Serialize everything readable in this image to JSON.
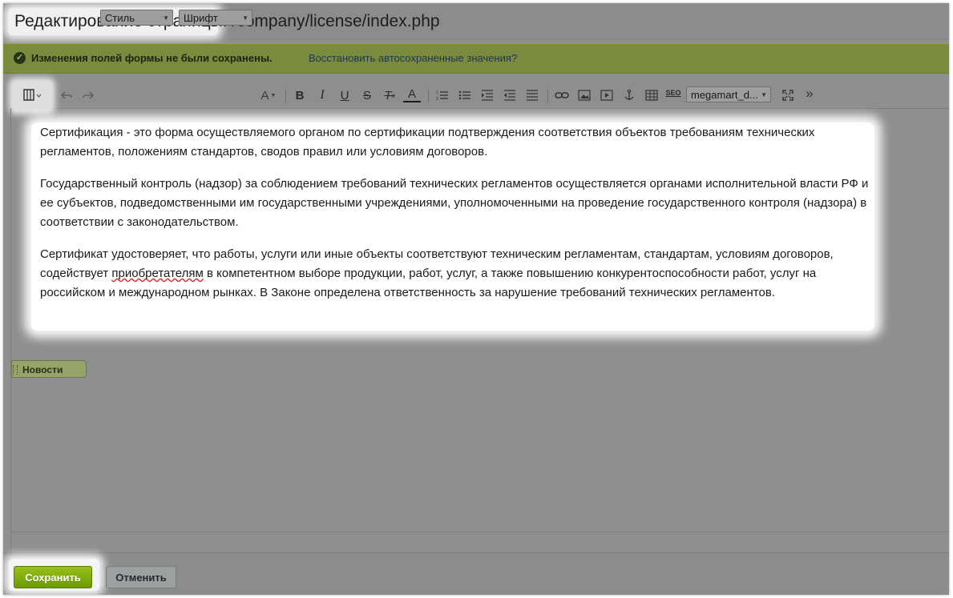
{
  "window": {
    "title": "Редактирование страницы:",
    "path": "/company/license/index.php"
  },
  "notice": {
    "icon": "check-circle-icon",
    "message": "Изменения полей формы не были сохранены.",
    "restore_link": "Восстановить автосохраненные значения?"
  },
  "toolbar": {
    "style_select": "Стиль",
    "font_select": "Шрифт",
    "font_size": "A",
    "bold": "B",
    "italic": "I",
    "underline": "U",
    "strike": "S",
    "clear_format": "T",
    "font_color": "A",
    "seo": "SEO",
    "template_select": "megamart_d...",
    "more": "»"
  },
  "content": {
    "p1": "Сертификация - это форма осуществляемого органом по сертификации подтверждения соответствия объектов требованиям технических регламентов, положениям стандартов, сводов правил или условиям договоров.",
    "p2": "Государственный контроль (надзор) за соблюдением требований технических регламентов осуществляется органами исполнительной власти РФ и ее субъектов, подведомственными им государственными учреждениями, уполномоченными на проведение государственного контроля (надзора) в соответствии с законодательством.",
    "p3_before": "Сертификат удостоверяет, что работы, услуги или иные объекты соответствуют техническим регламентам, стандартам, условиям договоров, содействует ",
    "p3_misspelled": "приобретателям",
    "p3_after": " в компетентном выборе продукции, работ, услуг, а также повышению конкурентоспособности работ, услуг на российском и международном рынках. В Законе определена ответственность за нарушение требований технических регламентов."
  },
  "news_tab": {
    "label": "Новости"
  },
  "footer": {
    "save": "Сохранить",
    "cancel": "Отменить"
  }
}
